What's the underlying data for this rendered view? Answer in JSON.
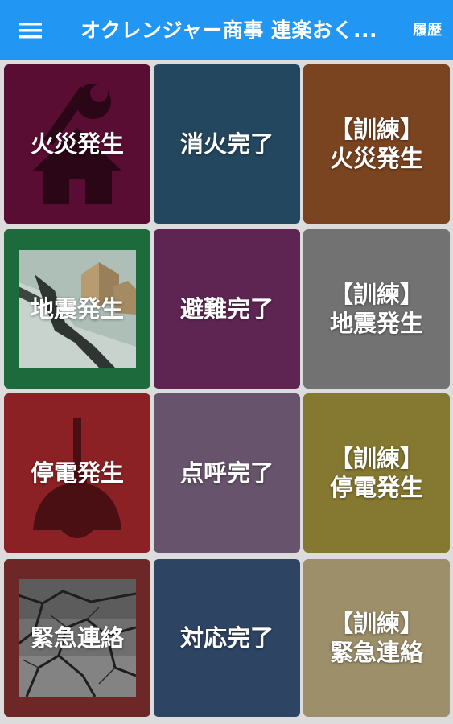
{
  "appbar": {
    "menu_icon": "hamburger-menu-icon",
    "title": "オクレンジャー商事 連楽おく...",
    "history_label": "履歴",
    "color": "#2196f3"
  },
  "tiles": [
    {
      "label": "火災発生",
      "color": "#5a0d33",
      "icon": "house-wrench-icon"
    },
    {
      "label": "消火完了",
      "color": "#244760"
    },
    {
      "label": "【訓練】\n火災発生",
      "color": "#7a4420"
    },
    {
      "label": "地震発生",
      "color": "#1d6b3c",
      "icon": "earthquake-photo"
    },
    {
      "label": "避難完了",
      "color": "#5e2553"
    },
    {
      "label": "【訓練】\n地震発生",
      "color": "#727272"
    },
    {
      "label": "停電発生",
      "color": "#8b2124",
      "icon": "hanging-lamp-icon"
    },
    {
      "label": "点呼完了",
      "color": "#67546c"
    },
    {
      "label": "【訓練】\n停電発生",
      "color": "#857830"
    },
    {
      "label": "緊急連絡",
      "color": "#6e2727",
      "icon": "cracked-ground-photo"
    },
    {
      "label": "対応完了",
      "color": "#2d4463"
    },
    {
      "label": "【訓練】\n緊急連絡",
      "color": "#9d8f6a"
    }
  ]
}
